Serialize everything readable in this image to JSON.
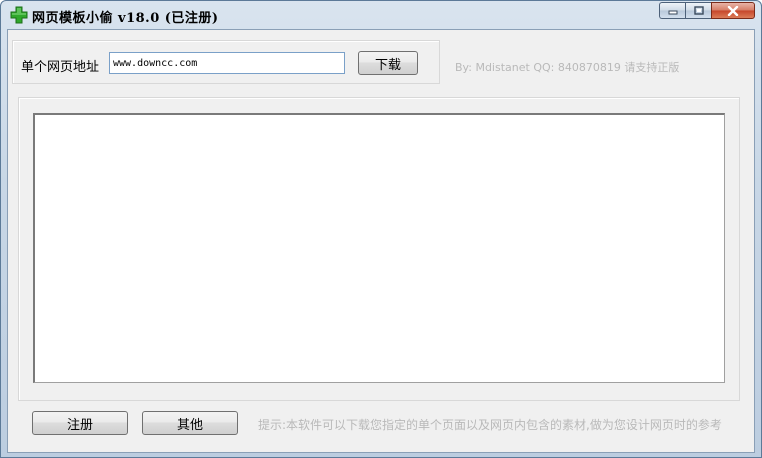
{
  "window": {
    "title": "网页模板小偷 v18.0 (已注册)"
  },
  "form": {
    "url_label": "单个网页地址",
    "url_value": "www.downcc.com",
    "download_label": "下载"
  },
  "credits": {
    "text": "By: Mdistanet QQ: 840870819 请支持正版"
  },
  "footer": {
    "register_label": "注册",
    "other_label": "其他",
    "hint": "提示:本软件可以下载您指定的单个页面以及网页内包含的素材,做为您设计网页时的参考"
  },
  "colors": {
    "icon_green": "#2fa82b",
    "hint_gray": "#b9b9b9"
  },
  "icons": {
    "app": "green-plus-icon",
    "minimize": "minimize-icon",
    "maximize": "maximize-icon",
    "close": "close-icon"
  }
}
